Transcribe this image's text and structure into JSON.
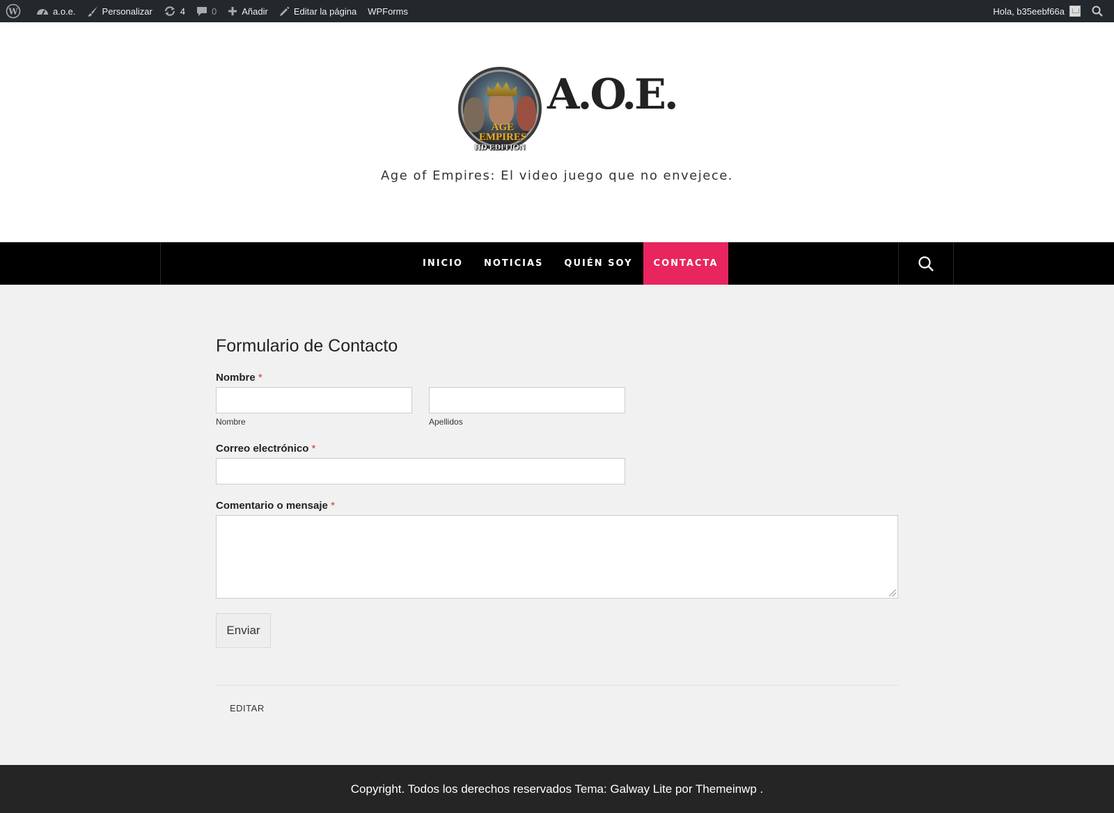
{
  "admin_bar": {
    "site_name": "a.o.e.",
    "customize": "Personalizar",
    "updates_count": "4",
    "comments_count": "0",
    "add_new": "Añadir",
    "edit_page": "Editar la página",
    "wpforms": "WPForms",
    "greeting": "Hola, b35eebf66a"
  },
  "header": {
    "site_title": "A.O.E.",
    "logo_text_line1": "AGE",
    "logo_text_line2": "EMPIRES",
    "logo_subtitle": "HD EDITION",
    "tagline": "Age of Empires: El video juego que no envejece."
  },
  "nav": {
    "items": [
      {
        "label": "INICIO"
      },
      {
        "label": "NOTICIAS"
      },
      {
        "label": "QUIÉN SOY"
      },
      {
        "label": "CONTACTA"
      }
    ],
    "active_color": "#e8255f"
  },
  "form": {
    "title": "Formulario de Contacto",
    "name_label": "Nombre",
    "required_mark": "*",
    "first_name_sublabel": "Nombre",
    "last_name_sublabel": "Apellidos",
    "email_label": "Correo electrónico",
    "message_label": "Comentario o mensaje",
    "submit_label": "Enviar"
  },
  "edit_link": "EDITAR",
  "footer": {
    "text": "Copyright. Todos los derechos reservados Tema: Galway Lite por Themeinwp ."
  }
}
